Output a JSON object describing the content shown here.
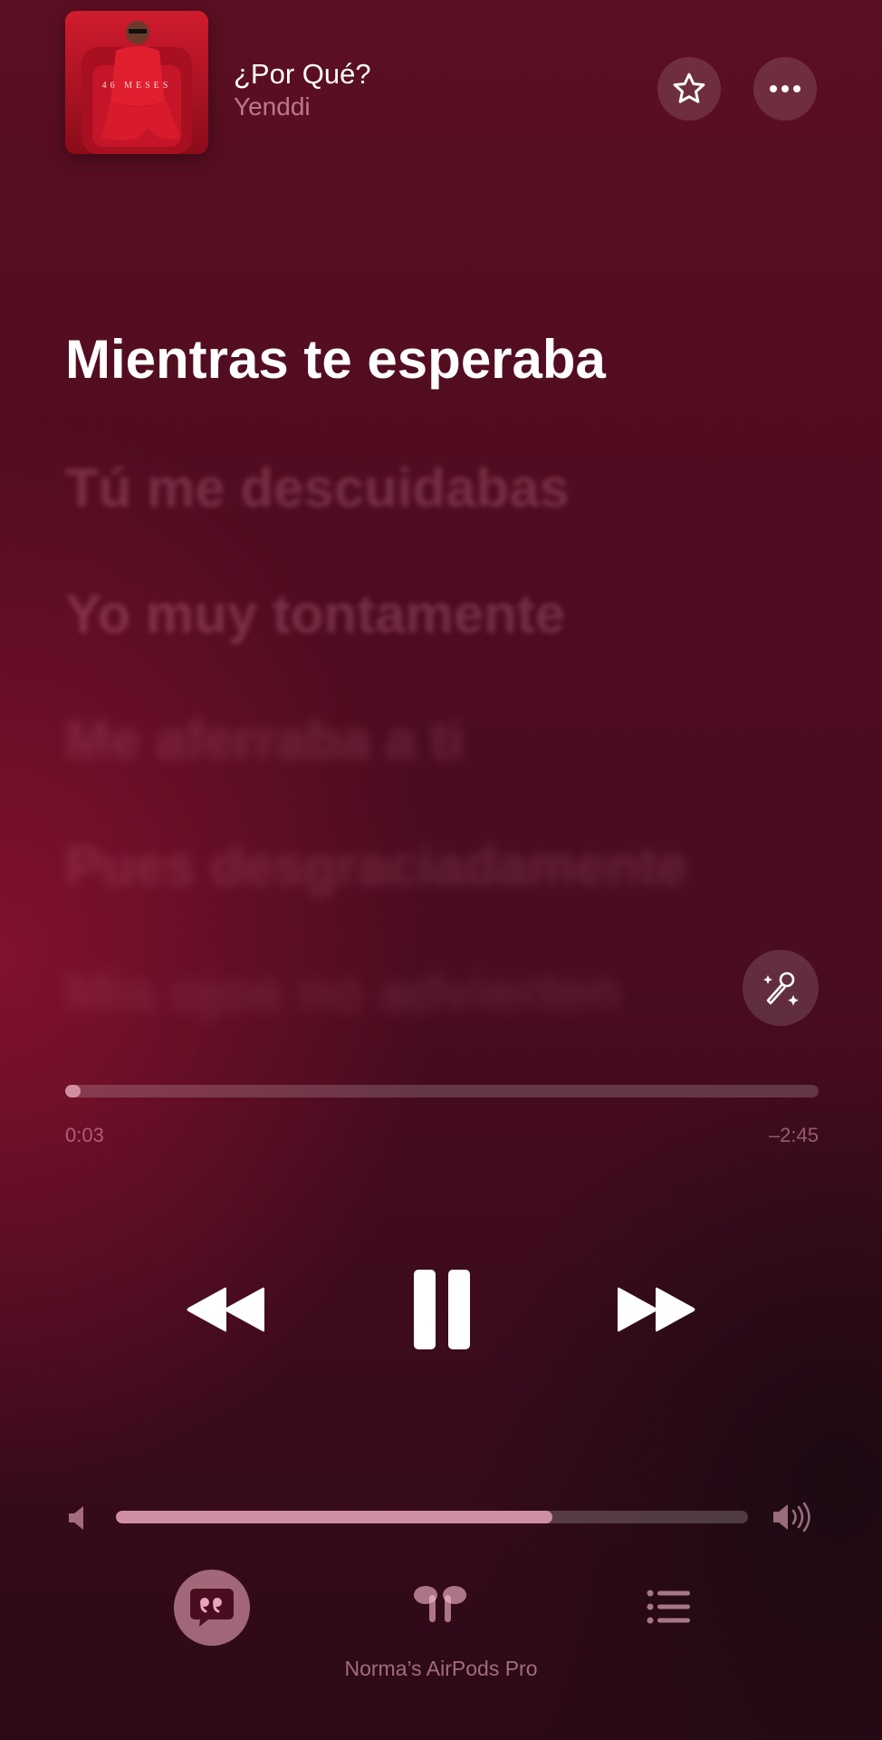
{
  "now_playing": {
    "title": "¿Por Qué?",
    "artist": "Yenddi",
    "artwork_text": "46 MESES"
  },
  "header": {
    "favorite_icon": "star-icon",
    "more_icon": "ellipsis-icon"
  },
  "lyrics": {
    "current": "Mientras te esperaba",
    "upcoming": [
      "Tú me descuidabas",
      "Yo muy tontamente",
      "Me aferraba a ti",
      "Pues desgraciadamente",
      "Mis ojos no advierten"
    ]
  },
  "sing_button": {
    "icon": "microphone-sparkles-icon"
  },
  "progress": {
    "elapsed": "0:03",
    "remaining": "–2:45",
    "fraction": 0.02
  },
  "transport": {
    "previous_icon": "backward-icon",
    "play_pause_icon": "pause-icon",
    "next_icon": "forward-icon"
  },
  "volume": {
    "level": 0.69,
    "min_icon": "speaker-low-icon",
    "max_icon": "speaker-high-icon"
  },
  "bottom_bar": {
    "lyrics_icon": "quote-bubble-icon",
    "airplay_icon": "airpods-icon",
    "queue_icon": "list-icon",
    "device_name": "Norma’s AirPods Pro"
  },
  "colors": {
    "background_top": "#5c0f22",
    "background_bottom": "#2b0a16",
    "accent_pink": "#e9a5be"
  }
}
